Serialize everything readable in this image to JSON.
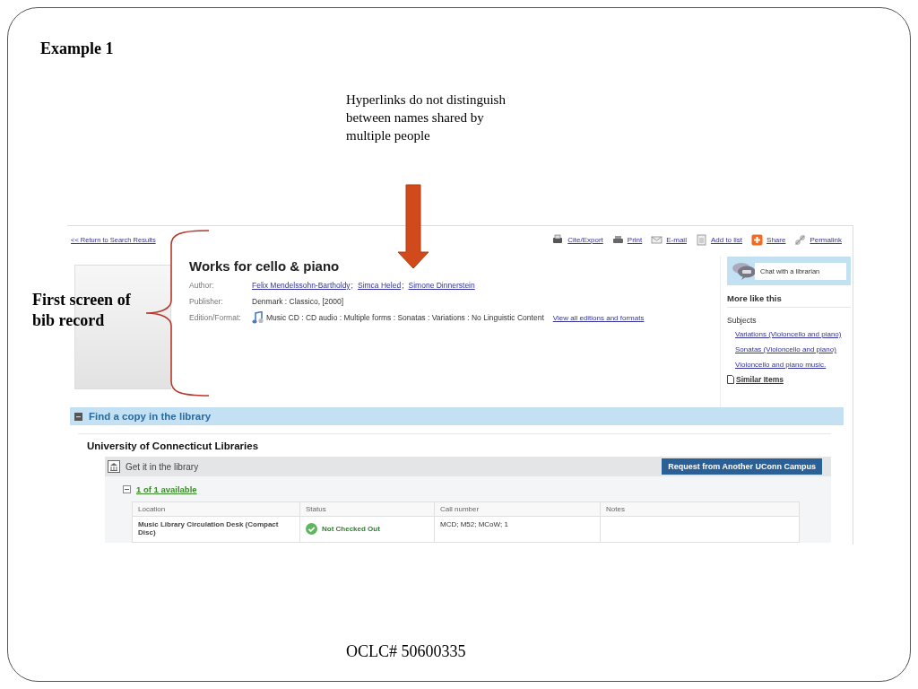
{
  "slide": {
    "title": "Example 1",
    "note": "Hyperlinks do not distinguish between names shared by multiple people",
    "callout": "First screen of bib record",
    "footer": "OCLC# 50600335"
  },
  "record": {
    "back_link": "<< Return to Search Results",
    "actions": [
      {
        "label": "Cite/Export",
        "kind": "cite"
      },
      {
        "label": "Print",
        "kind": "print"
      },
      {
        "label": "E-mail",
        "kind": "email"
      },
      {
        "label": "Add to list",
        "kind": "list"
      },
      {
        "label": "Share",
        "kind": "share"
      },
      {
        "label": "Permalink",
        "kind": "permalink"
      }
    ],
    "title": "Works for cello & piano",
    "fields": [
      {
        "label": "Author:",
        "kind": "links",
        "separator": ";",
        "values": [
          "Felix Mendelssohn-Bartholdy",
          "Simca Heled",
          "Simone Dinnerstein"
        ]
      },
      {
        "label": "Publisher:",
        "kind": "text",
        "value": "Denmark : Classico, [2000]"
      },
      {
        "label": "Edition/Format:",
        "kind": "format",
        "value": "Music CD : CD audio : Multiple forms : Sonatas : Variations : No Linguistic Content",
        "link": "View all editions and formats"
      }
    ]
  },
  "sidebar": {
    "chat": "Chat with a librarian",
    "heading": "More like this",
    "subjects_label": "Subjects",
    "subjects": [
      "Variations (Violoncello and piano)",
      "Sonatas (Violoncello and piano)",
      "Violoncello and piano music."
    ],
    "similar": "Similar Items"
  },
  "holdings": {
    "heading": "Find a copy in the library",
    "library": "University of Connecticut Libraries",
    "panel_title": "Get it in the library",
    "request_button": "Request from Another UConn Campus",
    "availability": "1 of 1 available",
    "expanded": true,
    "columns": [
      "Location",
      "Status",
      "Call number",
      "Notes"
    ],
    "rows": [
      {
        "location": "Music Library Circulation Desk (Compact Disc)",
        "status": "Not Checked Out",
        "kind": "available",
        "call_number": "MCD; M52; MCoW; 1"
      }
    ]
  }
}
